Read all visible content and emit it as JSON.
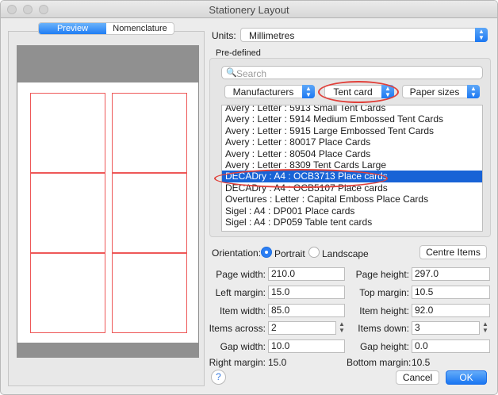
{
  "window": {
    "title": "Stationery Layout"
  },
  "preview_tabs": [
    "Preview",
    "Nomenclature"
  ],
  "units": {
    "label": "Units:",
    "value": "Millimetres"
  },
  "predefined": {
    "label": "Pre-defined",
    "search_placeholder": "Search",
    "filters": {
      "manufacturers": "Manufacturers",
      "category": "Tent card",
      "paper": "Paper sizes"
    },
    "items": [
      "Avery : Letter : 5913 Small Tent Cards",
      "Avery : Letter : 5914 Medium Embossed Tent Cards",
      "Avery : Letter : 5915 Large Embossed Tent Cards",
      "Avery : Letter : 80017 Place Cards",
      "Avery : Letter : 80504 Place Cards",
      "Avery : Letter : 8309 Tent Cards Large",
      "DECADry : A4 : OCB3713 Place cards",
      "DECADry : A4 : OCB5107 Place cards",
      "Overtures : Letter : Capital Emboss Place Cards",
      "Sigel : A4 : DP001 Place cards",
      "Sigel : A4 : DP059 Table tent cards"
    ],
    "selected_index": 6
  },
  "orientation": {
    "label": "Orientation:",
    "portrait": "Portrait",
    "landscape": "Landscape",
    "selected": "Portrait"
  },
  "centre_items": "Centre Items",
  "fields": {
    "page_width": {
      "label": "Page width:",
      "value": "210.0"
    },
    "page_height": {
      "label": "Page height:",
      "value": "297.0"
    },
    "left_margin": {
      "label": "Left margin:",
      "value": "15.0"
    },
    "top_margin": {
      "label": "Top margin:",
      "value": "10.5"
    },
    "item_width": {
      "label": "Item width:",
      "value": "85.0"
    },
    "item_height": {
      "label": "Item height:",
      "value": "92.0"
    },
    "items_across": {
      "label": "Items across:",
      "value": "2"
    },
    "items_down": {
      "label": "Items down:",
      "value": "3"
    },
    "gap_width": {
      "label": "Gap width:",
      "value": "10.0"
    },
    "gap_height": {
      "label": "Gap height:",
      "value": "0.0"
    },
    "right_margin": {
      "label": "Right margin:",
      "value": "15.0"
    },
    "bottom_margin": {
      "label": "Bottom margin:",
      "value": "10.5"
    }
  },
  "buttons": {
    "help": "?",
    "cancel": "Cancel",
    "ok": "OK"
  },
  "icons": {
    "search": "search-icon",
    "stepper": "updown-chevron-icon",
    "help": "question-icon"
  },
  "colors": {
    "accent": "#1f7df4",
    "selection": "#1863d6",
    "highlight_ellipse": "#e1403a",
    "card_outline": "#ee5858"
  }
}
